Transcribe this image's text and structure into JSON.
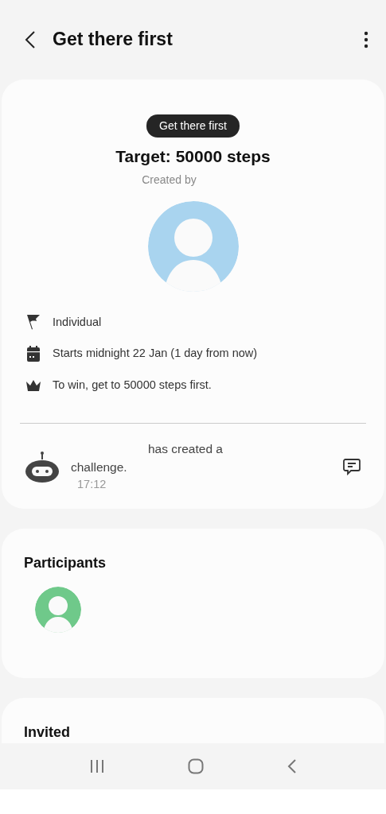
{
  "header": {
    "title": "Get there first"
  },
  "challenge": {
    "badge": "Get there first",
    "target": "Target: 50000 steps",
    "created_by_label": "Created by",
    "details": [
      {
        "kind": "flag",
        "text": "Individual"
      },
      {
        "kind": "calendar",
        "text": "Starts midnight 22 Jan (1 day from now)"
      },
      {
        "kind": "crown",
        "text": "To win, get to 50000 steps first."
      }
    ],
    "message": {
      "text": "has created a challenge.",
      "time": "17:12"
    }
  },
  "participants": {
    "title": "Participants"
  },
  "invited": {
    "title": "Invited"
  }
}
